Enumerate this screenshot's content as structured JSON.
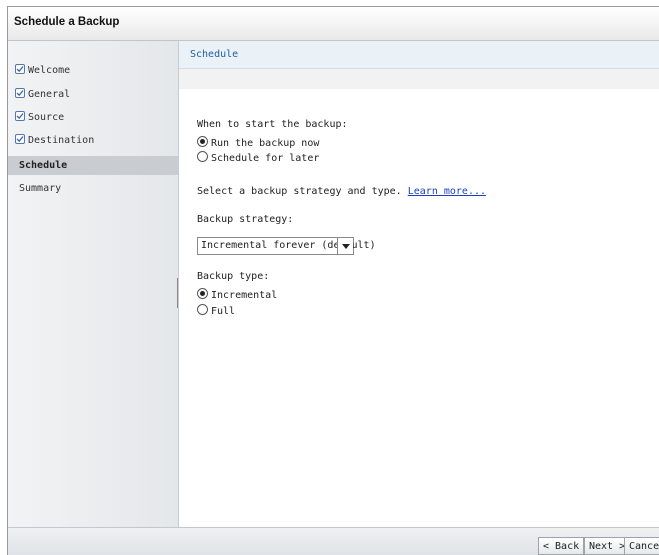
{
  "window": {
    "title": "Schedule a Backup"
  },
  "sidebar": {
    "items": [
      {
        "label": "Welcome",
        "checked": true
      },
      {
        "label": "General",
        "checked": true
      },
      {
        "label": "Source",
        "checked": true
      },
      {
        "label": "Destination",
        "checked": true
      },
      {
        "label": "Schedule",
        "checked": false,
        "active": true
      },
      {
        "label": "Summary",
        "checked": false
      }
    ]
  },
  "main": {
    "section_title": "Schedule",
    "when_label": "When to start the backup:",
    "when_options": [
      {
        "label": "Run the backup now",
        "selected": true
      },
      {
        "label": "Schedule for later",
        "selected": false
      }
    ],
    "strategy_prompt": "Select a backup strategy and type.",
    "learn_more": "Learn more...",
    "strategy_label": "Backup strategy:",
    "strategy_value": "Incremental forever (default)",
    "type_label": "Backup type:",
    "type_options": [
      {
        "label": "Incremental",
        "selected": true
      },
      {
        "label": "Full",
        "selected": false
      }
    ]
  },
  "footer": {
    "back_label": "< Back",
    "next_label": "Next >",
    "cancel_label": "Cancel"
  },
  "colors": {
    "accent_text": "#1f5fa0",
    "link": "#1a3fc4",
    "active_nav_bg": "#c9ccd1"
  },
  "icons": {
    "nav_check": "checkbox-checked-icon",
    "dropdown": "chevron-down-icon"
  }
}
